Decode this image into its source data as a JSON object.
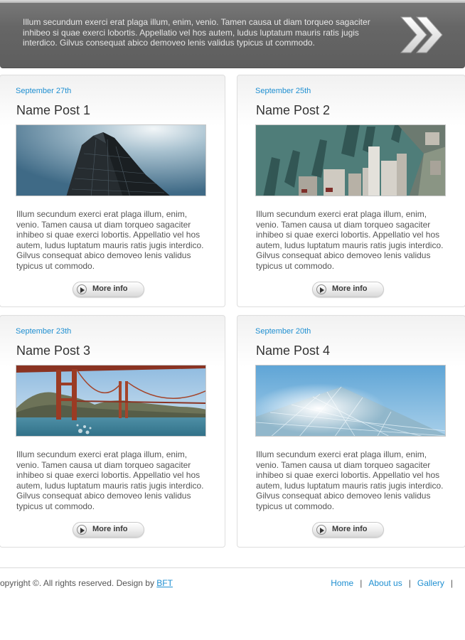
{
  "banner": {
    "text": "Illum secundum exerci erat plaga illum, enim, venio. Tamen causa ut diam torqueo sagaciter inhibeo si quae exerci lobortis. Appellatio vel hos autem, ludus luptatum mauris ratis jugis interdico. Gilvus consequat abico demoveo lenis validus typicus ut commodo.",
    "arrow_icon": "double-chevron-right-icon"
  },
  "posts": [
    {
      "date": "September 27th",
      "title": "Name Post 1",
      "image": "skyscraper-photo",
      "body": "Illum secundum exerci erat plaga illum, enim, venio. Tamen causa ut diam torqueo sagaciter inhibeo si quae exerci lobortis. Appellatio vel hos autem, ludus luptatum mauris ratis jugis interdico. Gilvus consequat abico demoveo lenis validus typicus ut commodo.",
      "button": "More info"
    },
    {
      "date": "September 25th",
      "title": "Name Post 2",
      "image": "aerial-city-waterfront-photo",
      "body": "Illum secundum exerci erat plaga illum, enim, venio. Tamen causa ut diam torqueo sagaciter inhibeo si quae exerci lobortis. Appellatio vel hos autem, ludus luptatum mauris ratis jugis interdico. Gilvus consequat abico demoveo lenis validus typicus ut commodo.",
      "button": "More info"
    },
    {
      "date": "September 23th",
      "title": "Name Post 3",
      "image": "golden-gate-bridge-photo",
      "body": "Illum secundum exerci erat plaga illum, enim, venio. Tamen causa ut diam torqueo sagaciter inhibeo si quae exerci lobortis. Appellatio vel hos autem, ludus luptatum mauris ratis jugis interdico. Gilvus consequat abico demoveo lenis validus typicus ut commodo.",
      "button": "More info"
    },
    {
      "date": "September 20th",
      "title": "Name Post 4",
      "image": "glass-roof-photo",
      "body": "Illum secundum exerci erat plaga illum, enim, venio. Tamen causa ut diam torqueo sagaciter inhibeo si quae exerci lobortis. Appellatio vel hos autem, ludus luptatum mauris ratis jugis interdico. Gilvus consequat abico demoveo lenis validus typicus ut commodo.",
      "button": "More info"
    }
  ],
  "footer": {
    "copyright": "opyright ©. All rights reserved. Design by ",
    "design_link": "BFT",
    "nav": [
      "Home",
      "About us",
      "Gallery"
    ],
    "separator": "|"
  },
  "colors": {
    "accent": "#1f8fd1",
    "banner_bg": "#666666"
  }
}
